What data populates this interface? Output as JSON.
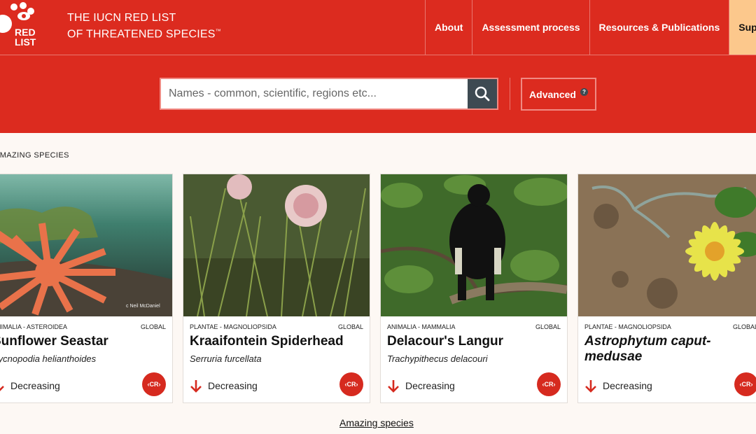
{
  "header": {
    "logo_text": "RED LIST",
    "title_line1": "THE IUCN RED LIST",
    "title_line2": "OF THREATENED SPECIES",
    "title_tm": "™",
    "nav": [
      {
        "label": "About"
      },
      {
        "label": "Assessment process"
      },
      {
        "label": "Resources & Publications"
      },
      {
        "label": "Support u"
      }
    ]
  },
  "search": {
    "placeholder": "Names - common, scientific, regions etc...",
    "advanced_label": "Advanced",
    "help_glyph": "?"
  },
  "section": {
    "title": "AMAZING SPECIES",
    "footer_link": "Amazing species"
  },
  "cards": [
    {
      "taxonomy": "ANIMALIA - ASTEROIDEA",
      "scope": "GLOBAL",
      "common_name": "Sunflower Seastar",
      "scientific_name": "Pycnopodia helianthoides",
      "trend": "Decreasing",
      "status": "CR",
      "credit": "c Neil McDaniel"
    },
    {
      "taxonomy": "PLANTAE - MAGNOLIOPSIDA",
      "scope": "GLOBAL",
      "common_name": "Kraaifontein Spiderhead",
      "scientific_name": "Serruria furcellata",
      "trend": "Decreasing",
      "status": "CR"
    },
    {
      "taxonomy": "ANIMALIA - MAMMALIA",
      "scope": "GLOBAL",
      "common_name": "Delacour's Langur",
      "scientific_name": "Trachypithecus delacouri",
      "trend": "Decreasing",
      "status": "CR"
    },
    {
      "taxonomy": "PLANTAE - MAGNOLIOPSIDA",
      "scope": "GLOBAL",
      "common_name": "Astrophytum caput-medusae",
      "scientific_name": "",
      "trend": "Decreasing",
      "status": "CR"
    }
  ],
  "colors": {
    "brand_red": "#dc2b1f",
    "support_bg": "#fcc88c",
    "search_btn": "#3e4a52"
  }
}
